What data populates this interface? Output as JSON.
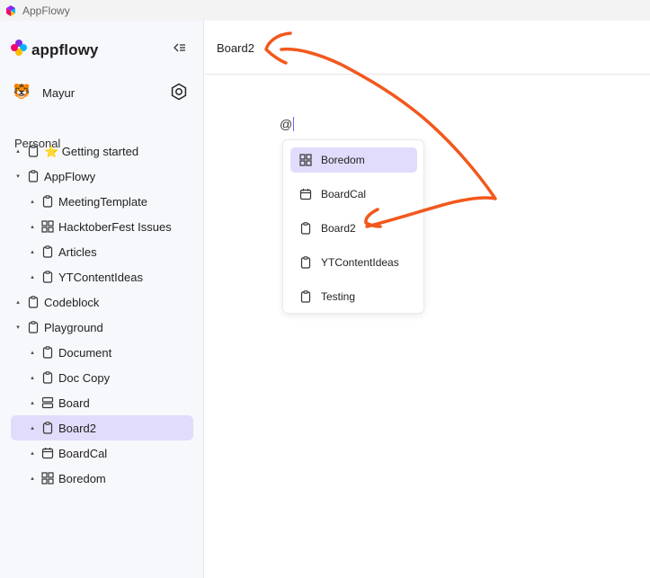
{
  "window": {
    "title": "AppFlowy"
  },
  "brand": {
    "name": "appflowy"
  },
  "user": {
    "name": "Mayur",
    "avatar": "🐯"
  },
  "sidebar": {
    "section": "Personal",
    "items": [
      {
        "label": "⭐ Getting started",
        "icon": "page-icon",
        "depth": 0
      },
      {
        "label": "AppFlowy",
        "icon": "page-icon",
        "depth": 0,
        "expanded": true
      },
      {
        "label": "MeetingTemplate",
        "icon": "page-icon",
        "depth": 1
      },
      {
        "label": "HacktoberFest Issues",
        "icon": "grid-icon",
        "depth": 1
      },
      {
        "label": "Articles",
        "icon": "page-icon",
        "depth": 1
      },
      {
        "label": "YTContentIdeas",
        "icon": "page-icon",
        "depth": 1
      },
      {
        "label": "Codeblock",
        "icon": "page-icon",
        "depth": 0
      },
      {
        "label": "Playground",
        "icon": "page-icon",
        "depth": 0,
        "expanded": true
      },
      {
        "label": "Document",
        "icon": "page-icon",
        "depth": 1
      },
      {
        "label": "Doc Copy",
        "icon": "page-icon",
        "depth": 1
      },
      {
        "label": "Board",
        "icon": "board-icon",
        "depth": 1
      },
      {
        "label": "Board2",
        "icon": "page-icon",
        "depth": 1,
        "selected": true
      },
      {
        "label": "BoardCal",
        "icon": "calendar-icon",
        "depth": 1
      },
      {
        "label": "Boredom",
        "icon": "grid-icon",
        "depth": 1
      }
    ]
  },
  "header": {
    "breadcrumb": "Board2"
  },
  "editor": {
    "text": "@"
  },
  "mention_menu": {
    "items": [
      {
        "label": "Boredom",
        "icon": "grid-icon",
        "active": true
      },
      {
        "label": "BoardCal",
        "icon": "calendar-icon"
      },
      {
        "label": "Board2",
        "icon": "page-icon"
      },
      {
        "label": "YTContentIdeas",
        "icon": "page-icon"
      },
      {
        "label": "Testing",
        "icon": "page-icon"
      }
    ]
  },
  "colors": {
    "accent": "#7b5cf5",
    "selection": "#e1dcfb",
    "annotation": "#f2581c",
    "sidebar_bg": "#f7f8fc"
  }
}
